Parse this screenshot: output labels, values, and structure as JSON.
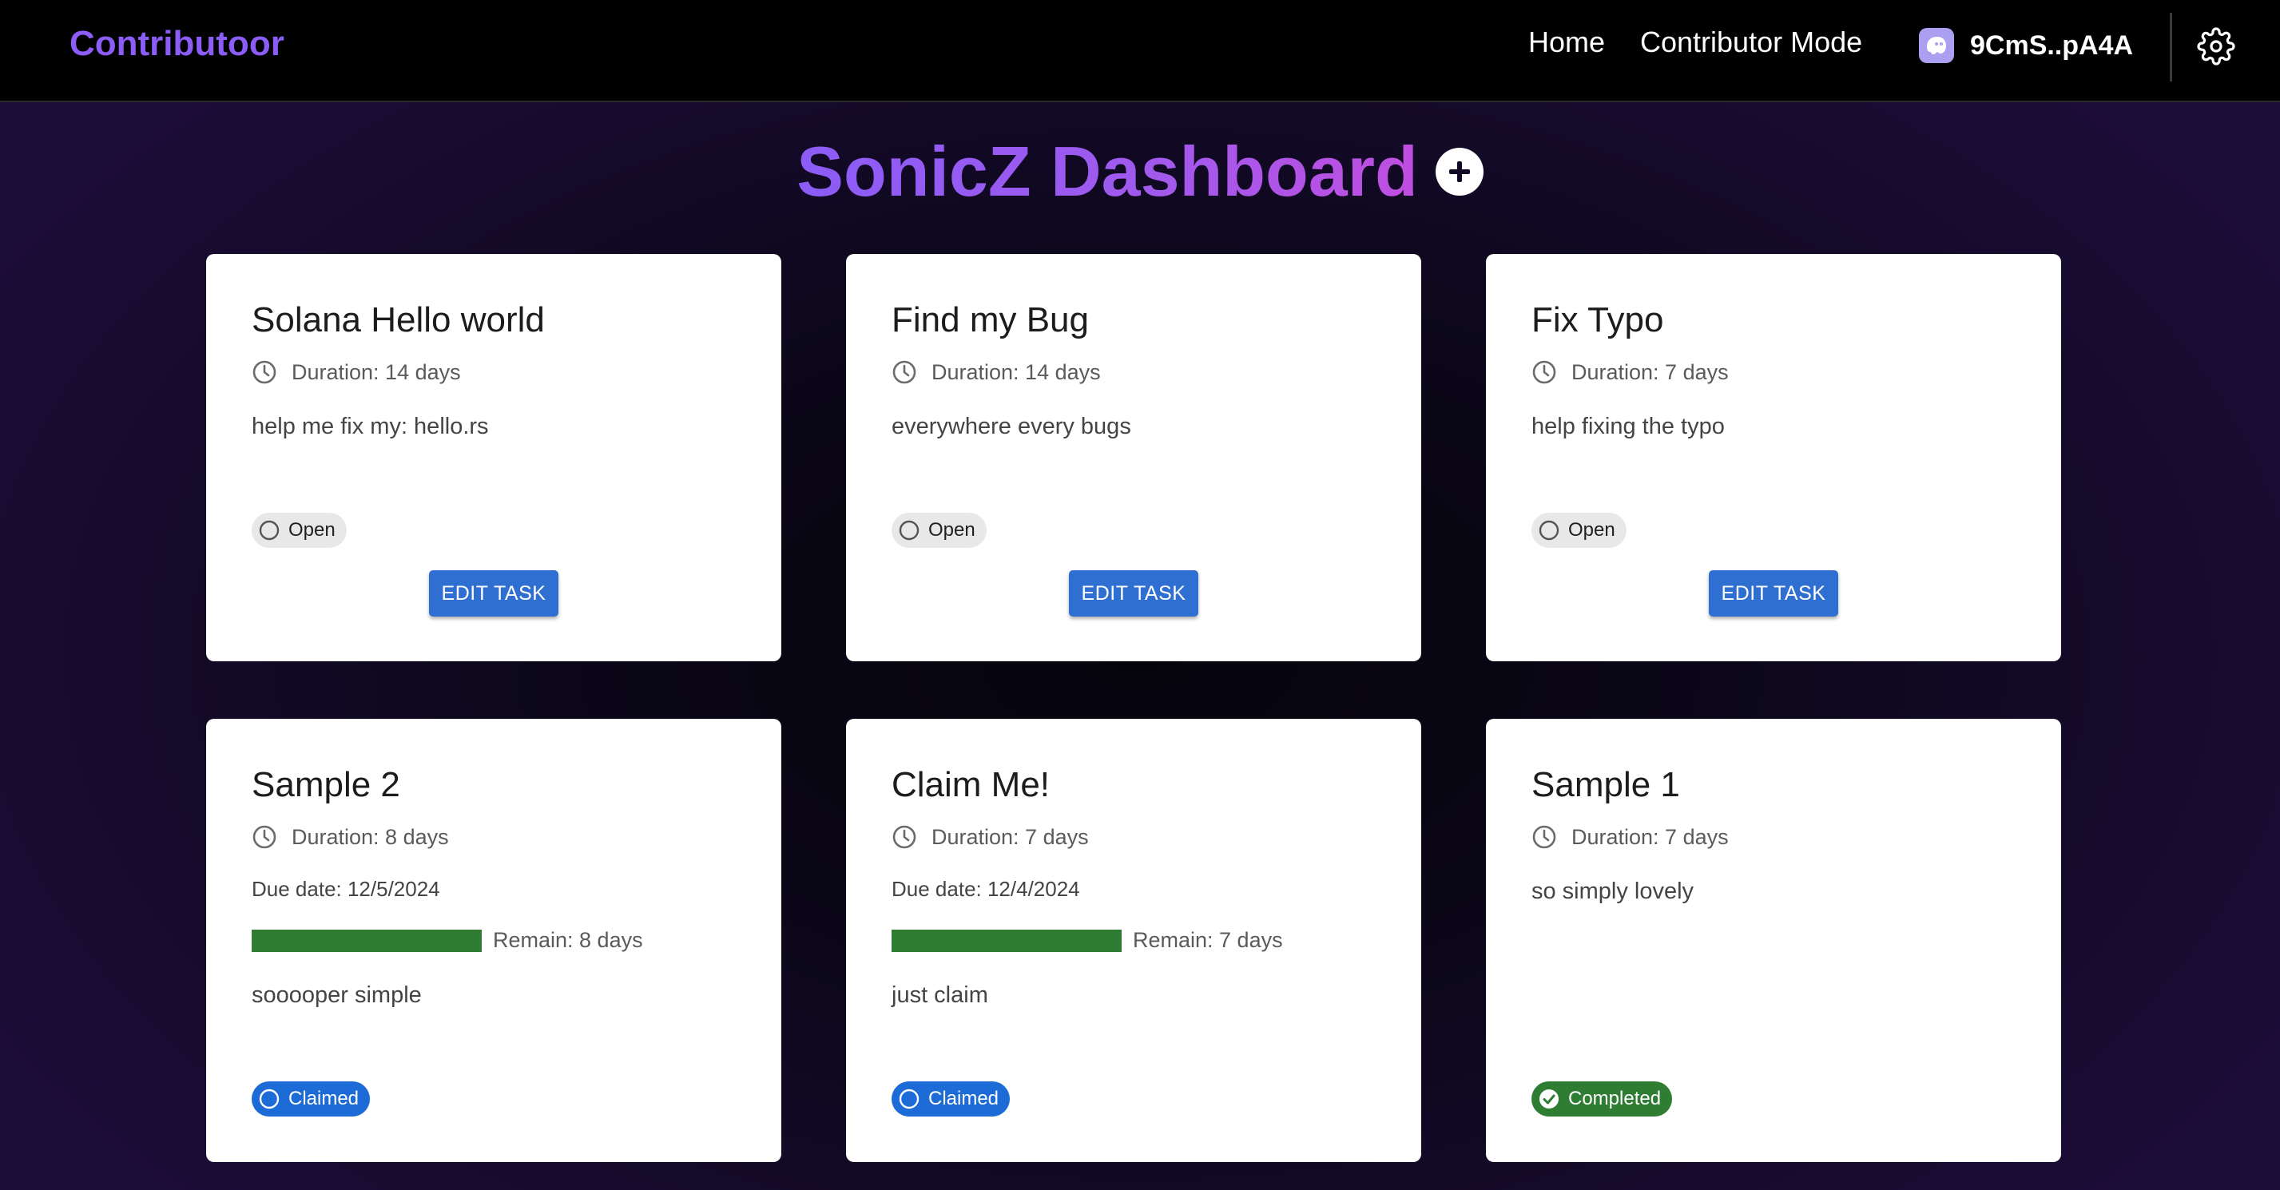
{
  "header": {
    "brand": "Contributoor",
    "nav": {
      "home": "Home",
      "contributor_mode": "Contributor Mode"
    },
    "wallet": {
      "label": "9CmS..pA4A",
      "icon": "ghost-wallet-icon"
    },
    "settings_icon": "gear-icon"
  },
  "page": {
    "title": "SonicZ Dashboard",
    "add_icon": "plus-circle-icon"
  },
  "colors": {
    "brand": "#8b5cf6",
    "edit_button": "#2f6fd1",
    "claimed": "#1d6bd6",
    "completed": "#2e7d32",
    "progress": "#2e7d32"
  },
  "tasks": [
    {
      "title": "Solana Hello world",
      "duration": "Duration: 14 days",
      "description": "help me fix my: hello.rs",
      "status": "Open",
      "action": "EDIT TASK"
    },
    {
      "title": "Find my Bug",
      "duration": "Duration: 14 days",
      "description": "everywhere every bugs",
      "status": "Open",
      "action": "EDIT TASK"
    },
    {
      "title": "Fix Typo",
      "duration": "Duration: 7 days",
      "description": "help fixing the typo",
      "status": "Open",
      "action": "EDIT TASK"
    },
    {
      "title": "Sample 2",
      "duration": "Duration: 8 days",
      "due_date": "Due date: 12/5/2024",
      "remain": "Remain: 8 days",
      "progress": 1.0,
      "description": "sooooper simple",
      "status": "Claimed"
    },
    {
      "title": "Claim Me!",
      "duration": "Duration: 7 days",
      "due_date": "Due date: 12/4/2024",
      "remain": "Remain: 7 days",
      "progress": 1.0,
      "description": "just claim",
      "status": "Claimed"
    },
    {
      "title": "Sample 1",
      "duration": "Duration: 7 days",
      "description": "so simply lovely",
      "status": "Completed"
    }
  ]
}
